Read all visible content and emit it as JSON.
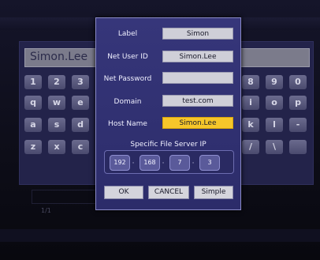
{
  "dialog": {
    "fields": [
      {
        "label": "Label",
        "value": "Simon",
        "active": false
      },
      {
        "label": "Net User ID",
        "value": "Simon.Lee",
        "active": false
      },
      {
        "label": "Net Password",
        "value": "",
        "active": false
      },
      {
        "label": "Domain",
        "value": "test.com",
        "active": false
      },
      {
        "label": "Host Name",
        "value": "Simon.Lee",
        "active": true
      }
    ],
    "ip_title": "Specific File Server IP",
    "ip": [
      "192",
      "168",
      "7",
      "3"
    ],
    "buttons": {
      "ok": "OK",
      "cancel": "CANCEL",
      "simple": "Simple"
    },
    "active_field_color": "#f6c62a"
  },
  "background": {
    "input_text": "Simon.Lee",
    "keys_row1": [
      "1",
      "2",
      "3",
      "8",
      "9",
      "0"
    ],
    "keys_row2": [
      "q",
      "w",
      "e",
      "i",
      "o",
      "p"
    ],
    "keys_row3": [
      "a",
      "s",
      "d",
      "k",
      "l",
      "-"
    ],
    "keys_row4": [
      "z",
      "x",
      "c",
      "/",
      "\\",
      ""
    ],
    "page_indicator": "1/1"
  }
}
